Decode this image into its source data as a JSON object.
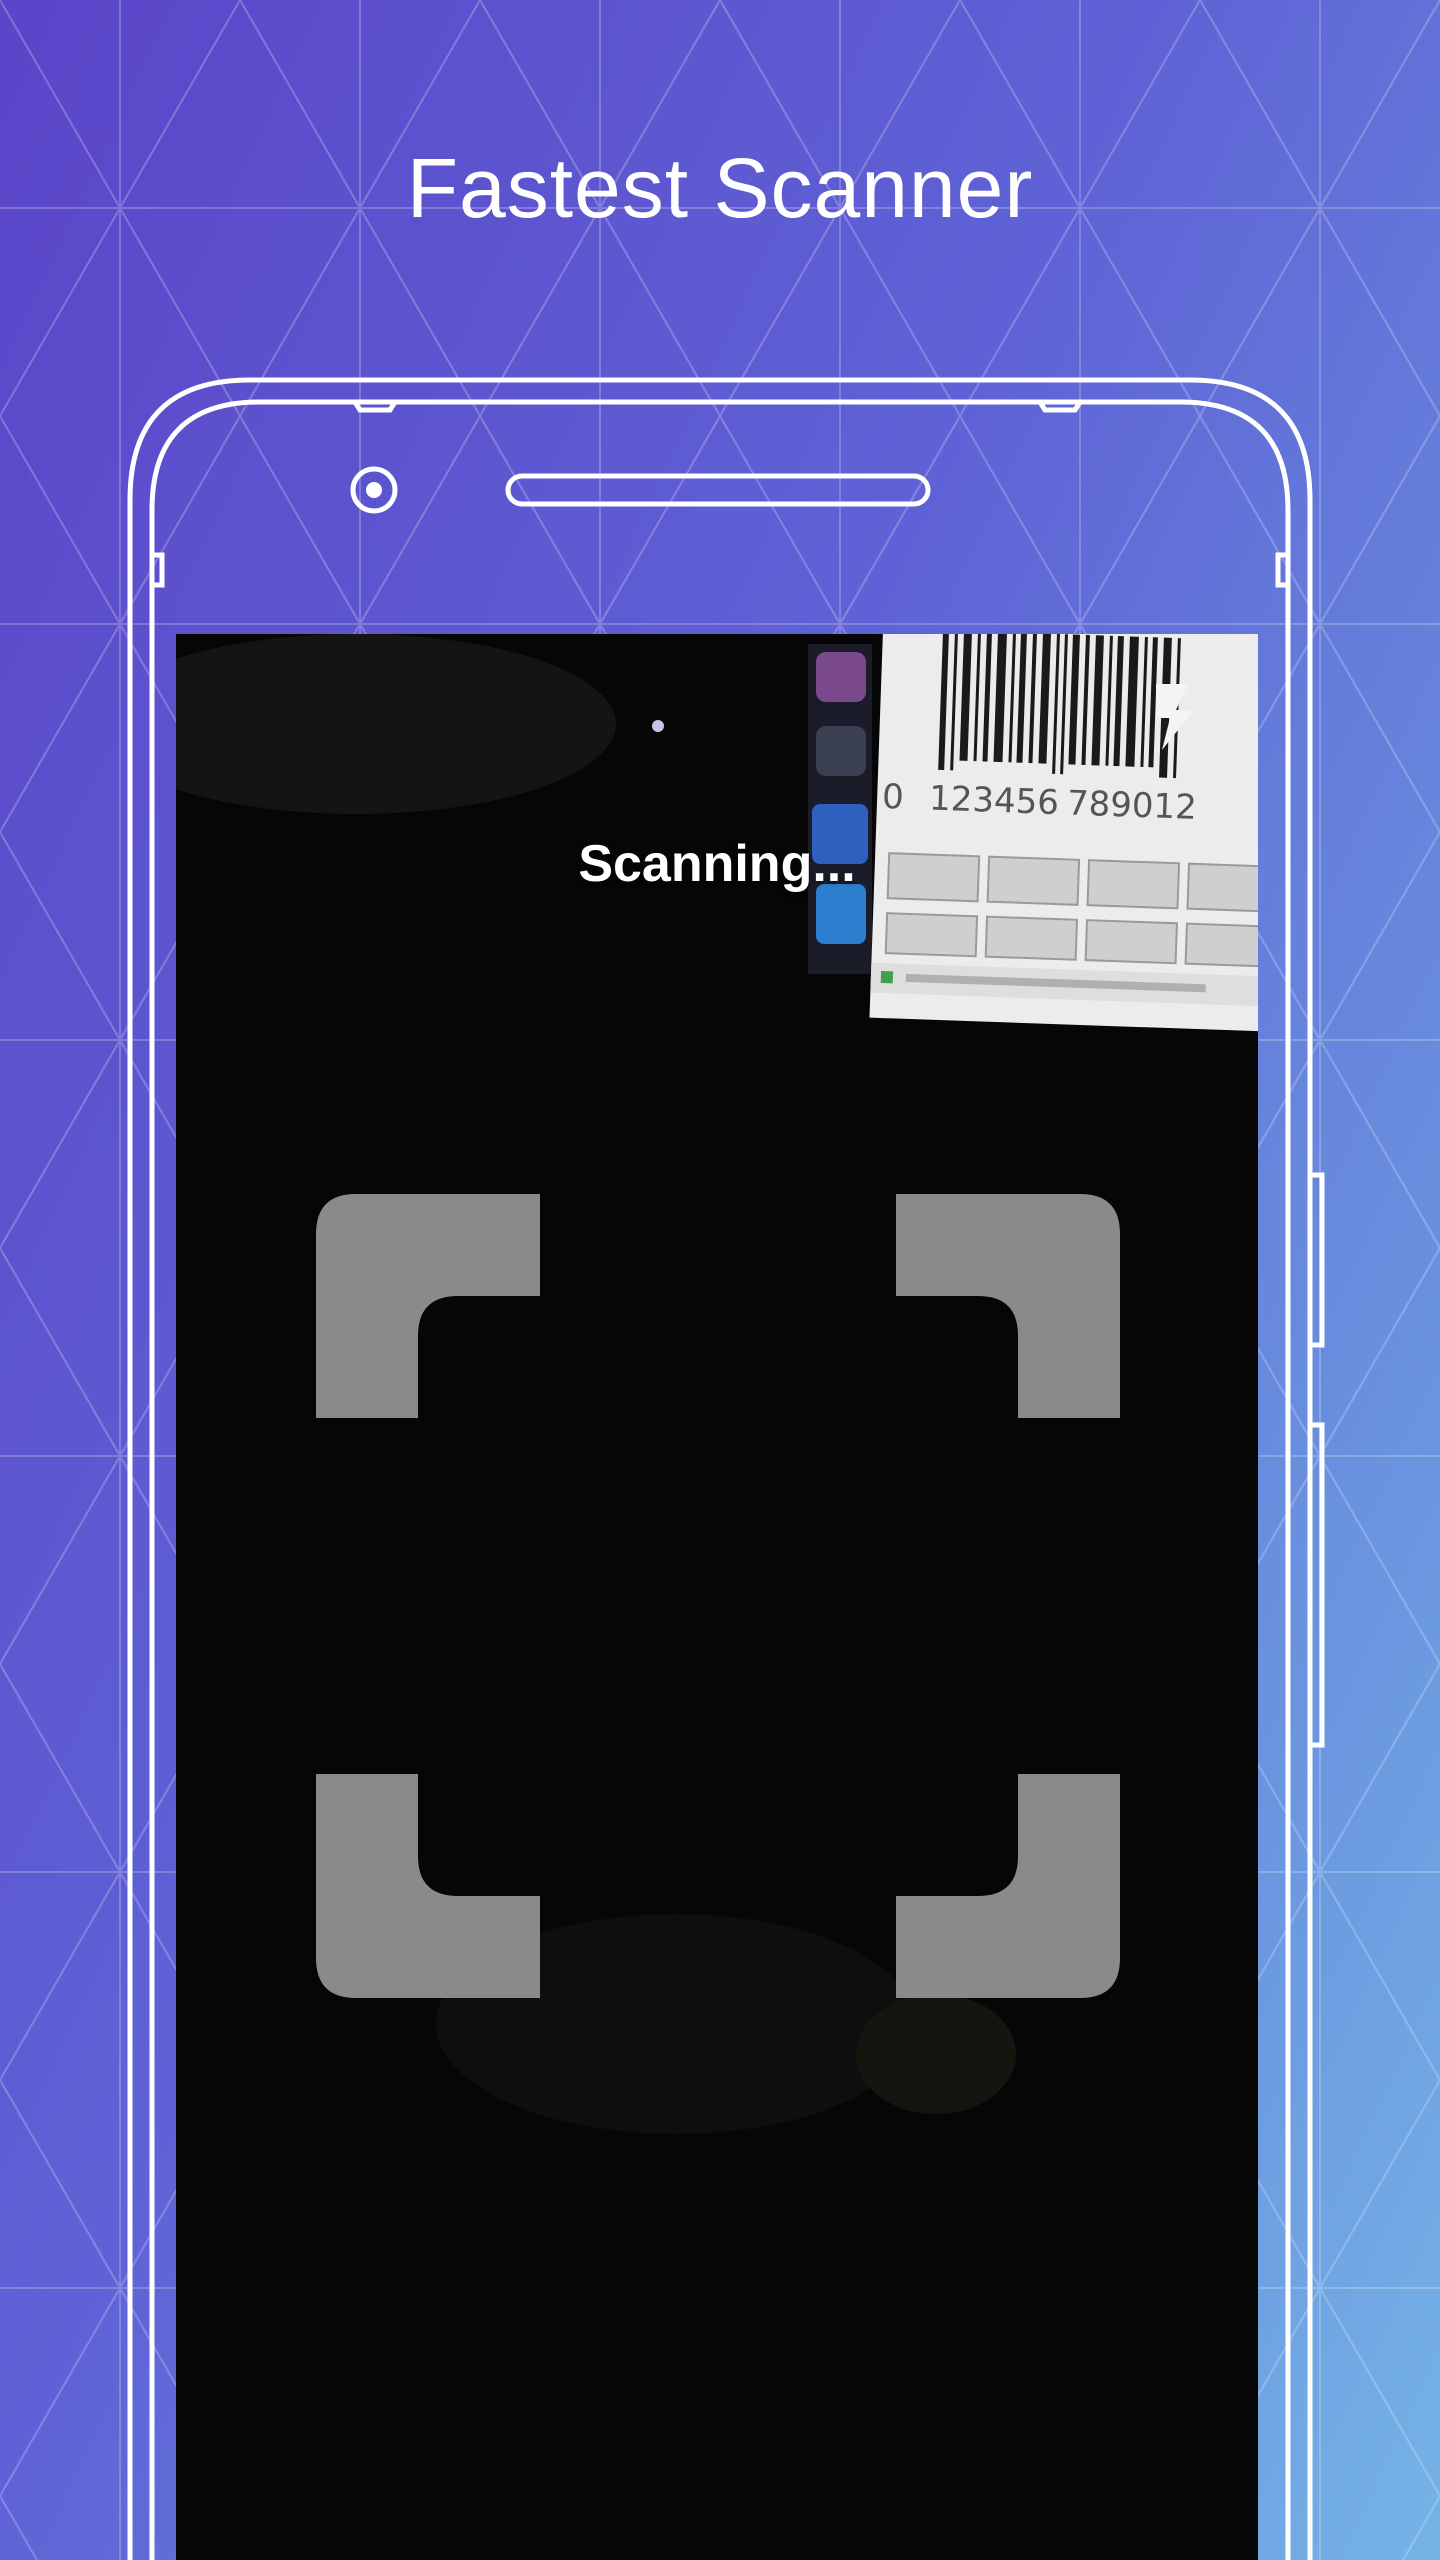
{
  "promo": {
    "headline": "Fastest Scanner"
  },
  "scanner": {
    "status_text": "Scanning...",
    "flash_icon": "flash-icon",
    "viewfinder_icon": "scan-frame-corners"
  },
  "colors": {
    "background_start": "#5a45c8",
    "background_end": "#75b3e6",
    "viewfinder": "#8a8a8a",
    "outline": "#ffffff",
    "screen": "#070707"
  }
}
